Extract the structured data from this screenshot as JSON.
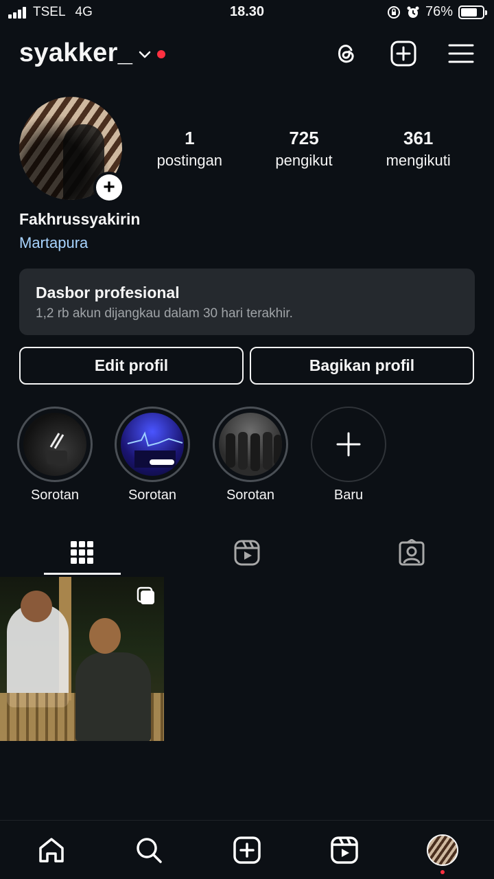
{
  "status_bar": {
    "carrier": "TSEL",
    "network": "4G",
    "time": "18.30",
    "battery_percent": "76%",
    "battery_level": 0.76
  },
  "header": {
    "username": "syakker_",
    "icons": [
      "chevron-down-icon",
      "threads-icon",
      "create-post-icon",
      "menu-icon"
    ],
    "notification_dot_color": "#ff3040"
  },
  "profile": {
    "stats": [
      {
        "value": "1",
        "label": "postingan"
      },
      {
        "value": "725",
        "label": "pengikut"
      },
      {
        "value": "361",
        "label": "mengikuti"
      }
    ],
    "full_name": "Fakhrussyakirin",
    "location": "Martapura",
    "location_color": "#a8d4ff"
  },
  "dashboard": {
    "title": "Dasbor profesional",
    "subtitle": "1,2 rb akun dijangkau dalam 30 hari terakhir."
  },
  "actions": {
    "edit_label": "Edit profil",
    "share_label": "Bagikan profil"
  },
  "highlights": [
    {
      "label": "Sorotan"
    },
    {
      "label": "Sorotan"
    },
    {
      "label": "Sorotan"
    },
    {
      "label": "Baru"
    }
  ],
  "tabs": [
    "grid-icon",
    "reels-icon",
    "tagged-icon"
  ],
  "bottom_nav": [
    "home-icon",
    "search-icon",
    "create-icon",
    "reels-icon",
    "profile-avatar"
  ]
}
